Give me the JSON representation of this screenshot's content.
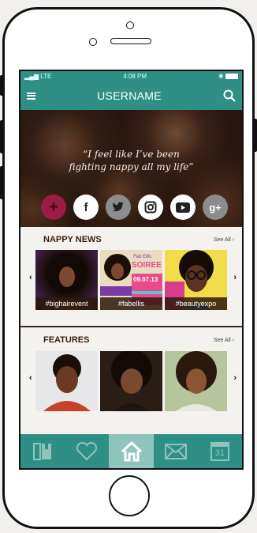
{
  "status": {
    "carrier": "LTE",
    "time": "4:08 PM"
  },
  "nav": {
    "title": "USERNAME"
  },
  "hero": {
    "quote_line1": "“I feel like I’ve been",
    "quote_line2": "fighting nappy all my life”"
  },
  "social": [
    {
      "name": "plus",
      "glyph": "+"
    },
    {
      "name": "facebook",
      "glyph": "f"
    },
    {
      "name": "twitter",
      "glyph": "t"
    },
    {
      "name": "instagram",
      "glyph": "▣"
    },
    {
      "name": "youtube",
      "glyph": "▶"
    },
    {
      "name": "google-plus",
      "glyph": "g+"
    }
  ],
  "news": {
    "title": "NAPPY NEWS",
    "see_all": "See All ›",
    "items": [
      {
        "tag": "#bighairevent"
      },
      {
        "tag": "#fabellis",
        "poster_line1": "Fab Ellis",
        "poster_line2": "SOIREE",
        "poster_date": "09.07.13"
      },
      {
        "tag": "#beautyexpo"
      }
    ]
  },
  "features": {
    "title": "FEATURES",
    "see_all": "See All ›"
  },
  "tabbar": {
    "calendar_day": "31"
  },
  "colors": {
    "teal": "#2f8f84",
    "active_tab": "#8fc4bd",
    "accent": "#9b1c44"
  }
}
